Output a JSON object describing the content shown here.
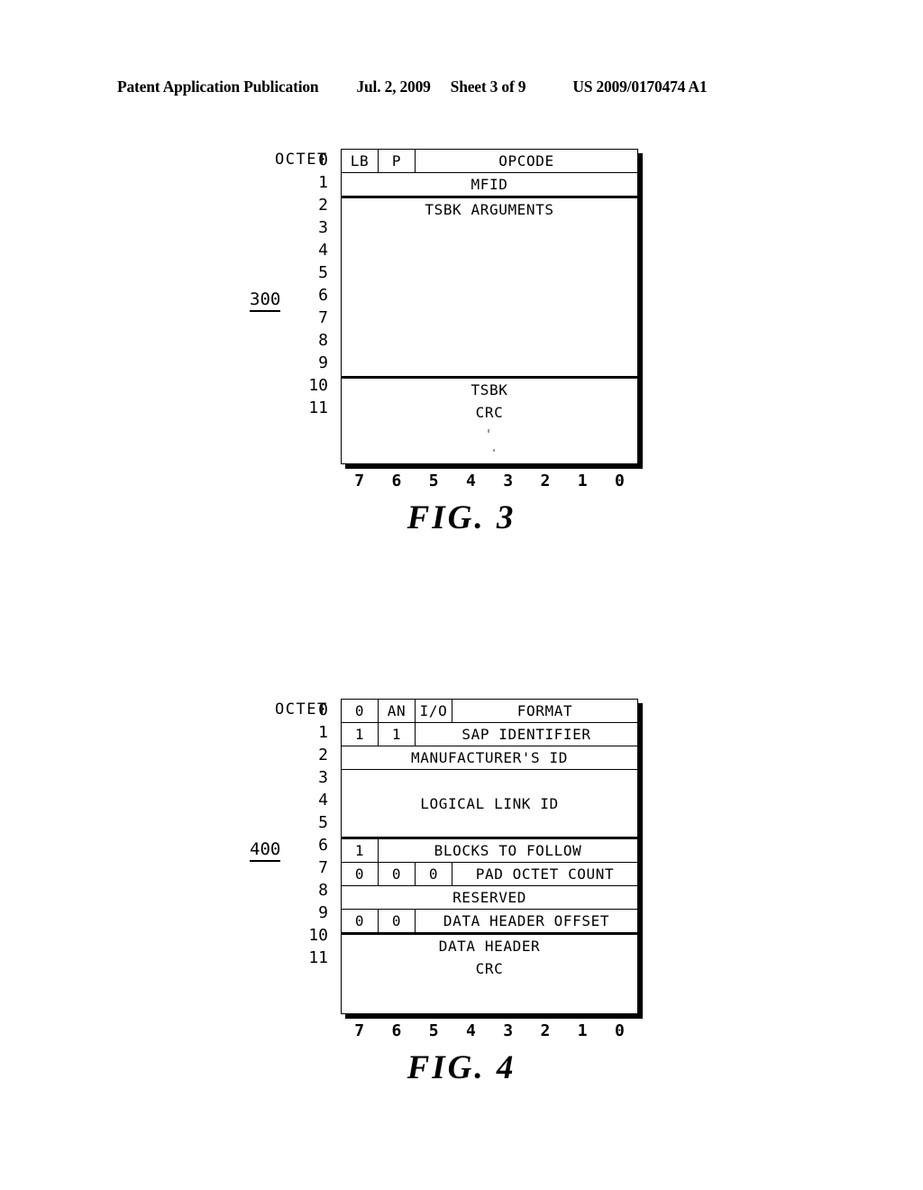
{
  "header": {
    "publication": "Patent Application Publication",
    "date": "Jul. 2, 2009",
    "sheet": "Sheet 3 of 9",
    "patent_number": "US 2009/0170474 A1"
  },
  "figures": [
    {
      "id": "fig3",
      "caption": "FIG. 3",
      "reference_numeral": "300",
      "octet_axis_label": "OCTET",
      "octet_numbers": [
        "0",
        "1",
        "2",
        "3",
        "4",
        "5",
        "6",
        "7",
        "8",
        "9",
        "10",
        "11"
      ],
      "bit_numbers": [
        "7",
        "6",
        "5",
        "4",
        "3",
        "2",
        "1",
        "0"
      ],
      "rows": [
        {
          "octet": "0",
          "cells": [
            {
              "label": "LB",
              "bits": 1
            },
            {
              "label": "P",
              "bits": 1
            },
            {
              "label": "OPCODE",
              "bits": 6
            }
          ]
        },
        {
          "octet": "1",
          "cells": [
            {
              "label": "MFID",
              "bits": 8
            }
          ]
        }
      ],
      "blocks": [
        {
          "label": "TSBK ARGUMENTS",
          "octets": [
            "2",
            "3",
            "4",
            "5",
            "6",
            "7",
            "8",
            "9"
          ],
          "align": "top"
        },
        {
          "label": "TSBK\nCRC",
          "octets": [
            "10",
            "11"
          ],
          "align": "top"
        }
      ]
    },
    {
      "id": "fig4",
      "caption": "FIG. 4",
      "reference_numeral": "400",
      "octet_axis_label": "OCTET",
      "octet_numbers": [
        "0",
        "1",
        "2",
        "3",
        "4",
        "5",
        "6",
        "7",
        "8",
        "9",
        "10",
        "11"
      ],
      "bit_numbers": [
        "7",
        "6",
        "5",
        "4",
        "3",
        "2",
        "1",
        "0"
      ],
      "rows": [
        {
          "octet": "0",
          "cells": [
            {
              "label": "0",
              "bits": 1
            },
            {
              "label": "AN",
              "bits": 1
            },
            {
              "label": "I/O",
              "bits": 1
            },
            {
              "label": "FORMAT",
              "bits": 5
            }
          ]
        },
        {
          "octet": "1",
          "cells": [
            {
              "label": "1",
              "bits": 1
            },
            {
              "label": "1",
              "bits": 1
            },
            {
              "label": "SAP IDENTIFIER",
              "bits": 6
            }
          ]
        },
        {
          "octet": "2",
          "cells": [
            {
              "label": "MANUFACTURER'S ID",
              "bits": 8
            }
          ]
        },
        {
          "octet": "6",
          "cells": [
            {
              "label": "1",
              "bits": 1
            },
            {
              "label": "BLOCKS TO FOLLOW",
              "bits": 7
            }
          ]
        },
        {
          "octet": "7",
          "cells": [
            {
              "label": "0",
              "bits": 1
            },
            {
              "label": "0",
              "bits": 1
            },
            {
              "label": "0",
              "bits": 1
            },
            {
              "label": "PAD OCTET COUNT",
              "bits": 5
            }
          ]
        },
        {
          "octet": "8",
          "cells": [
            {
              "label": "RESERVED",
              "bits": 8
            }
          ]
        },
        {
          "octet": "9",
          "cells": [
            {
              "label": "0",
              "bits": 1
            },
            {
              "label": "0",
              "bits": 1
            },
            {
              "label": "DATA HEADER OFFSET",
              "bits": 6
            }
          ]
        }
      ],
      "blocks": [
        {
          "label": "LOGICAL LINK ID",
          "octets": [
            "3",
            "4",
            "5"
          ],
          "align": "center"
        },
        {
          "label": "DATA HEADER\nCRC",
          "octets": [
            "10",
            "11"
          ],
          "align": "top"
        }
      ]
    }
  ]
}
